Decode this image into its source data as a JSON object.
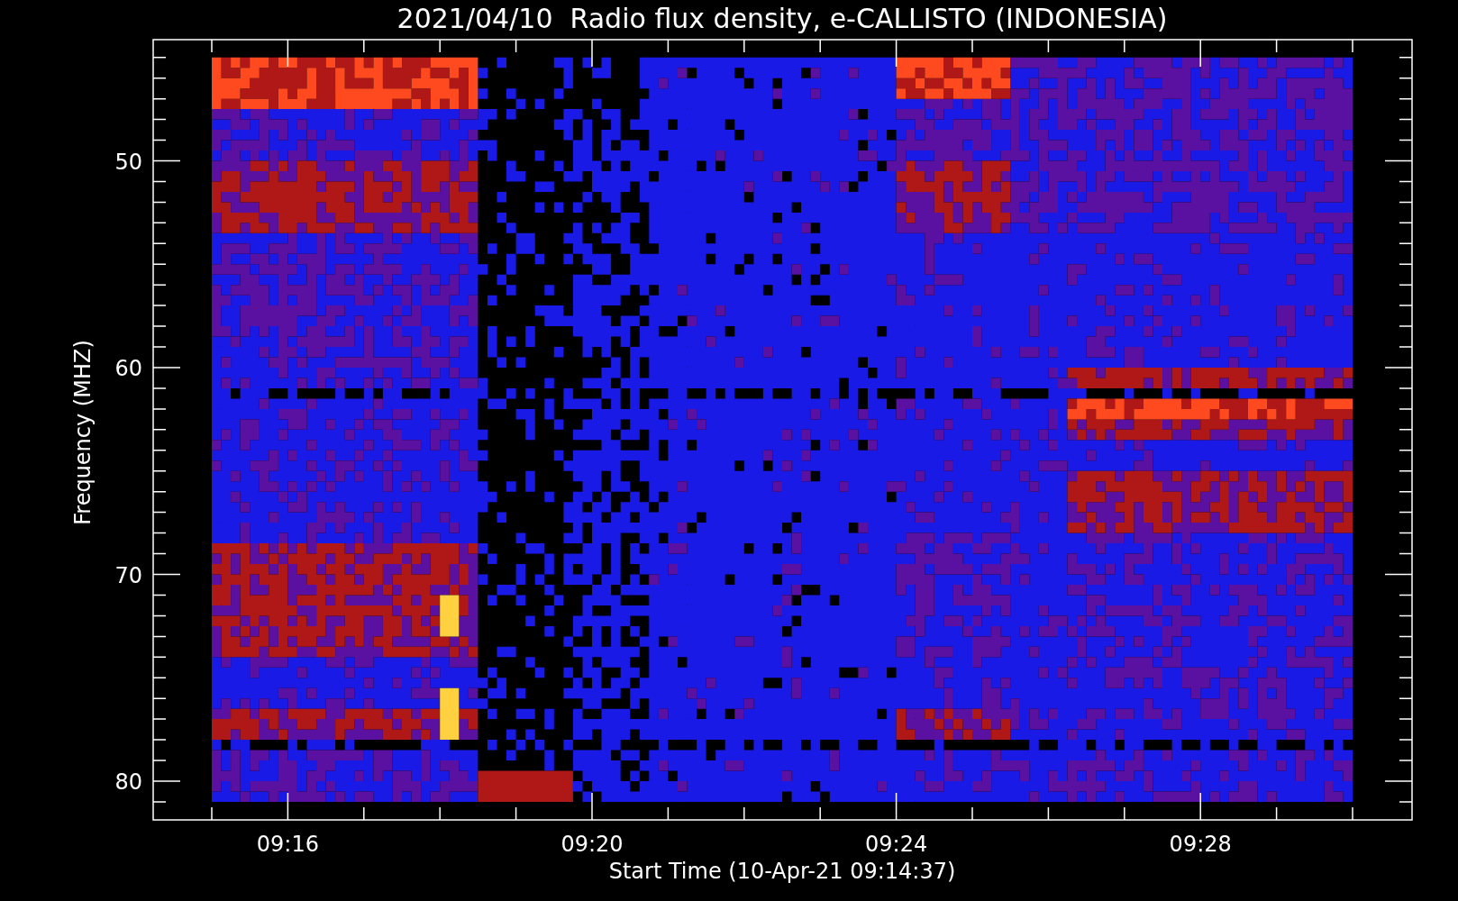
{
  "title": "2021/04/10  Radio flux density, e-CALLISTO (INDONESIA)",
  "y_axis": {
    "label": "Frequency (MHZ)",
    "ticks": [
      "50",
      "60",
      "70",
      "80"
    ]
  },
  "x_axis": {
    "label": "Start Time (10-Apr-21 09:14:37)",
    "ticks": [
      "09:16",
      "09:20",
      "09:24",
      "09:28"
    ]
  }
}
